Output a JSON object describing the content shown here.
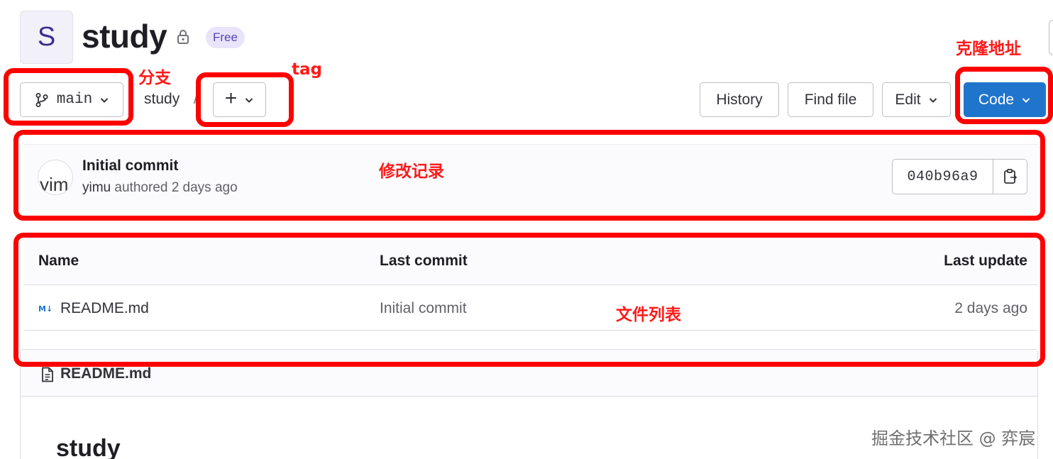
{
  "project": {
    "avatar_letter": "S",
    "name": "study",
    "badge": "Free"
  },
  "toolbar": {
    "branch": "main",
    "breadcrumb": "study",
    "breadcrumb_sep": "/",
    "add_symbol": "+",
    "history_label": "History",
    "find_file_label": "Find file",
    "edit_label": "Edit",
    "code_label": "Code"
  },
  "last_commit": {
    "avatar_text": "yim",
    "title": "Initial commit",
    "author": "yimu",
    "meta": "authored 2 days ago",
    "sha": "040b96a9"
  },
  "file_table": {
    "headers": {
      "name": "Name",
      "last_commit": "Last commit",
      "last_update": "Last update"
    },
    "rows": [
      {
        "icon_text": "M↓",
        "name": "README.md",
        "last_commit": "Initial commit",
        "last_update": "2 days ago"
      }
    ]
  },
  "readme": {
    "filename": "README.md",
    "heading": "study"
  },
  "annotations": {
    "branch": "分支",
    "tag": "tag",
    "clone": "克隆地址",
    "commit_log": "修改记录",
    "file_list": "文件列表"
  },
  "watermark": "掘金技术社区 @ 弈宸",
  "colors": {
    "primary_button": "#1f75cb",
    "annotation_red": "#ff0000",
    "badge_bg": "#e9e4fb"
  },
  "icons": [
    "lock-icon",
    "branch-icon",
    "chevron-down-icon",
    "plus-icon",
    "copy-icon",
    "markdown-icon",
    "file-icon"
  ]
}
